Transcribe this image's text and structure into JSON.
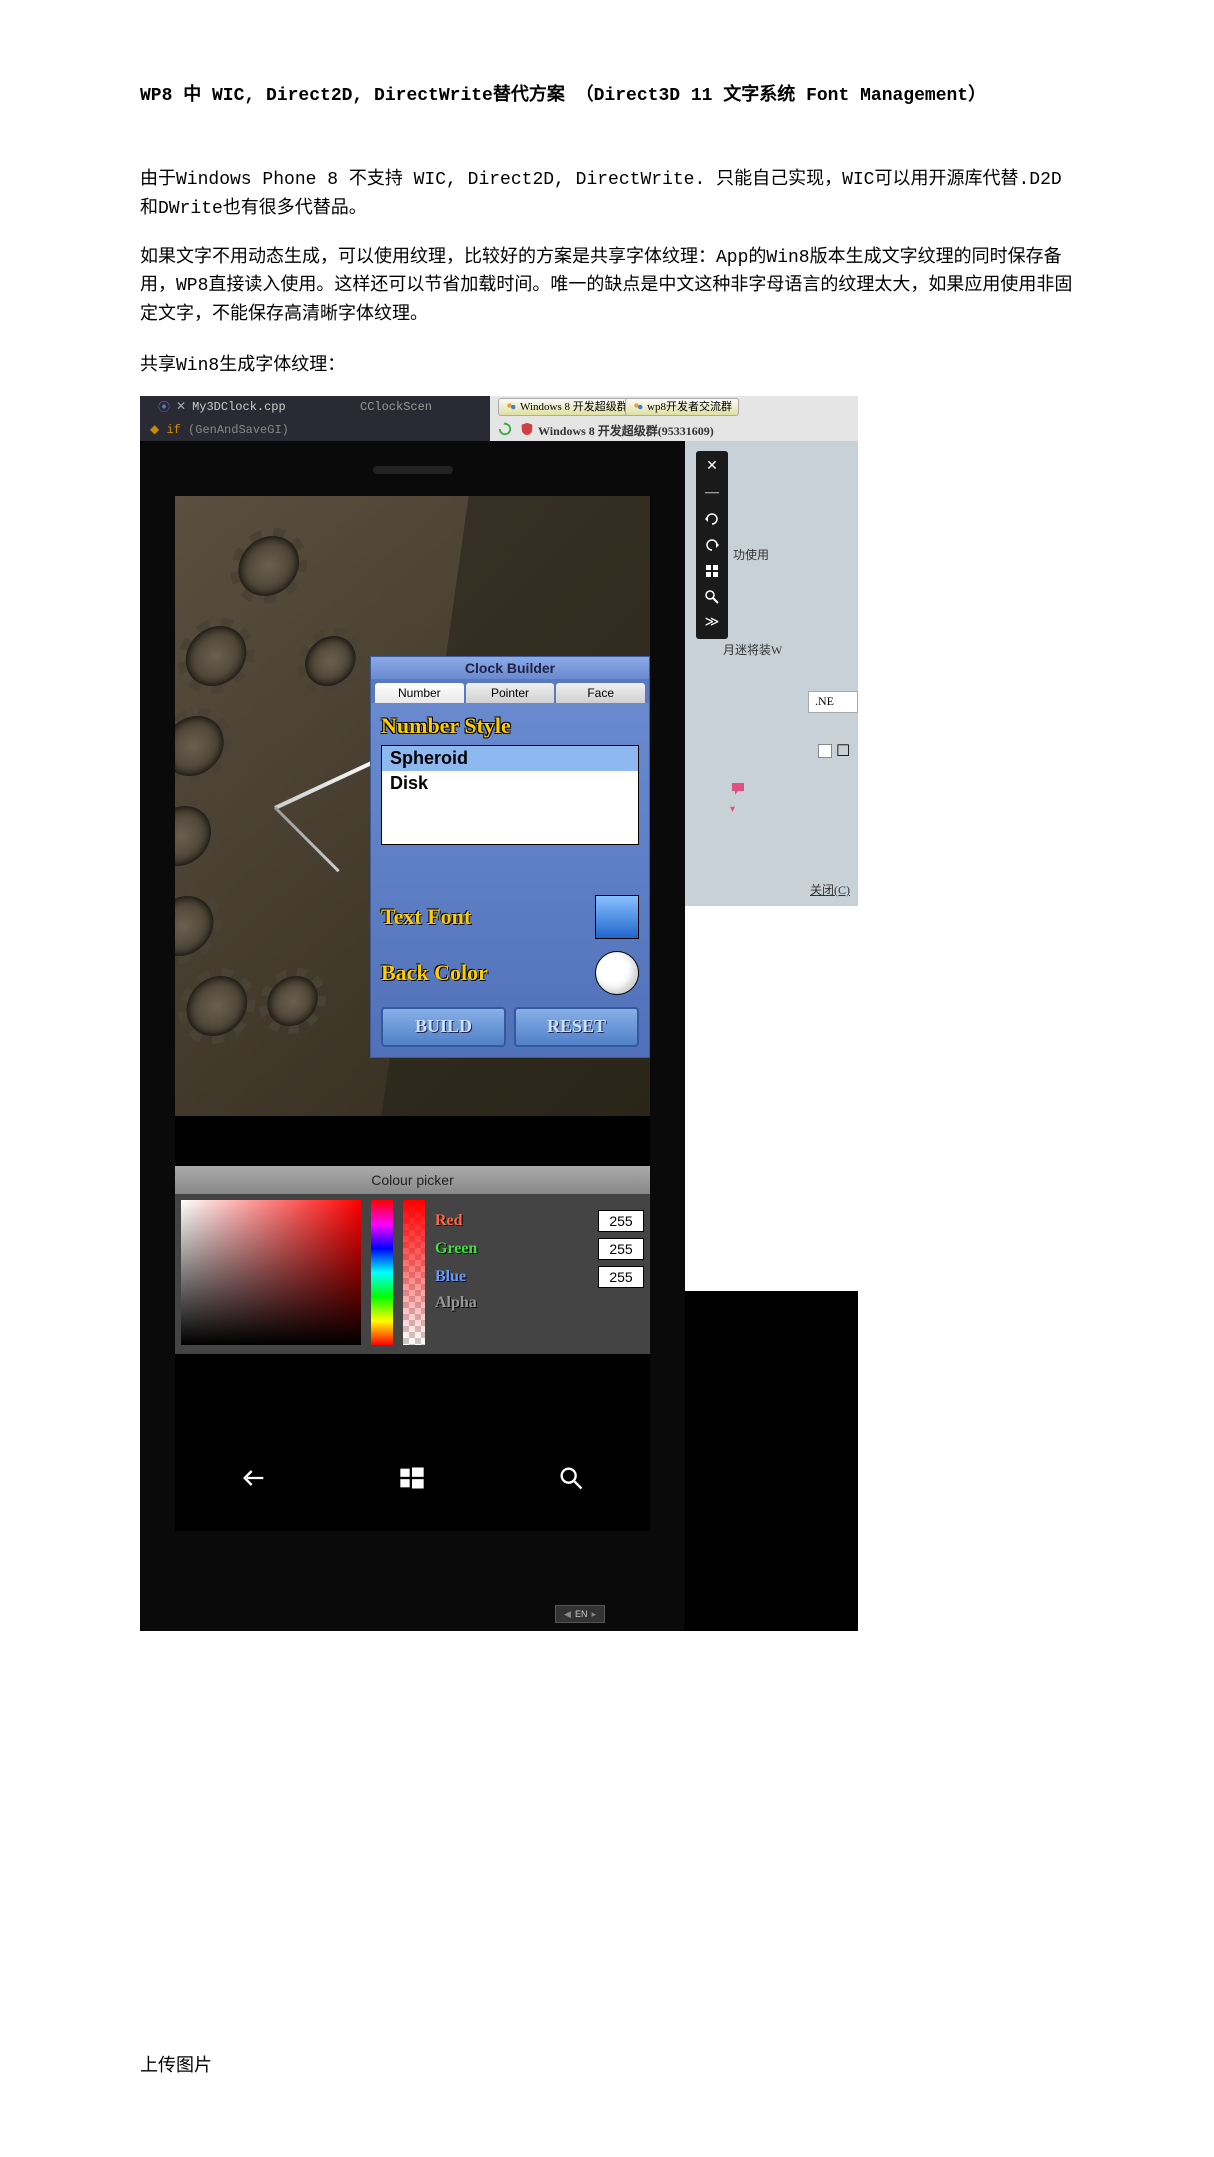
{
  "article": {
    "title": "WP8 中 WIC, Direct2D, DirectWrite替代方案 （Direct3D 11 文字系统 Font Management）",
    "para1": "由于Windows Phone 8 不支持 WIC, Direct2D, DirectWrite. 只能自己实现，WIC可以用开源库代替.D2D和DWrite也有很多代替品。",
    "para2": "如果文字不用动态生成，可以使用纹理，比较好的方案是共享字体纹理：App的Win8版本生成文字纹理的同时保存备用，WP8直接读入使用。这样还可以节省加载时间。唯一的缺点是中文这种非字母语言的纹理太大，如果应用使用非固定文字，不能保存高清晰字体纹理。",
    "label1": "共享Win8生成字体纹理：",
    "bottom_label": "上传图片"
  },
  "vs": {
    "tab_file": "My3DClock.cpp",
    "tab_other": "CClockScen",
    "code_if": "if",
    "code_cond": "(GenAndSaveGI)"
  },
  "qq": {
    "tab1_label": "Windows 8 开发超级群",
    "tab2_label": "wp8开发者交流群",
    "group_title": "Windows 8 开发超级群(95331609)"
  },
  "right": {
    "text1": "功使用",
    "text2": "月迷将装W",
    "ne_label": ".NE",
    "close_label": "关闭(C)"
  },
  "builder": {
    "title": "Clock Builder",
    "tabs": [
      "Number",
      "Pointer",
      "Face"
    ],
    "section_label": "Number Style",
    "options": [
      "Spheroid",
      "Disk"
    ],
    "selected": "Spheroid",
    "font_label": "Text Font",
    "backcolor_label": "Back Color",
    "build_btn": "BUILD",
    "reset_btn": "RESET"
  },
  "picker": {
    "title": "Colour picker",
    "r_label": "Red",
    "g_label": "Green",
    "b_label": "Blue",
    "a_label": "Alpha",
    "r_val": "255",
    "g_val": "255",
    "b_val": "255"
  },
  "ime": {
    "lang": "EN"
  }
}
